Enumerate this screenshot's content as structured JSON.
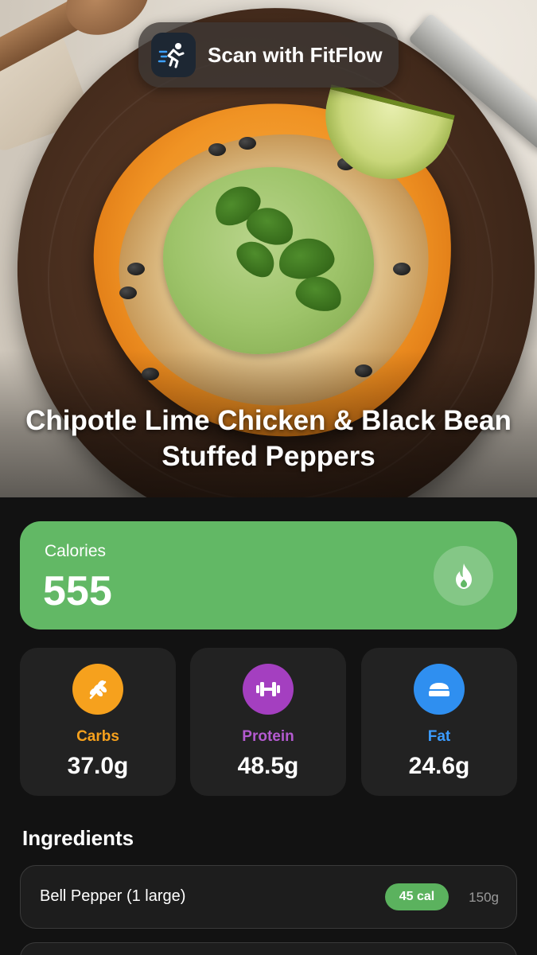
{
  "scan": {
    "label": "Scan with FitFlow",
    "icon": "runner-icon"
  },
  "recipe": {
    "title": "Chipotle Lime Chicken & Black Bean Stuffed Peppers"
  },
  "calories": {
    "label": "Calories",
    "value": "555",
    "icon": "flame-icon",
    "color": "#62b865"
  },
  "macros": [
    {
      "name": "Carbs",
      "value": "37.0g",
      "icon": "wheat-icon",
      "color": "#f6a11d"
    },
    {
      "name": "Protein",
      "value": "48.5g",
      "icon": "dumbbell-icon",
      "color": "#a43fc0"
    },
    {
      "name": "Fat",
      "value": "24.6g",
      "icon": "butter-icon",
      "color": "#2f8ff0"
    }
  ],
  "ingredients": {
    "heading": "Ingredients",
    "items": [
      {
        "name": "Bell Pepper (1 large)",
        "calories": "45 cal",
        "weight": "150g"
      }
    ]
  }
}
